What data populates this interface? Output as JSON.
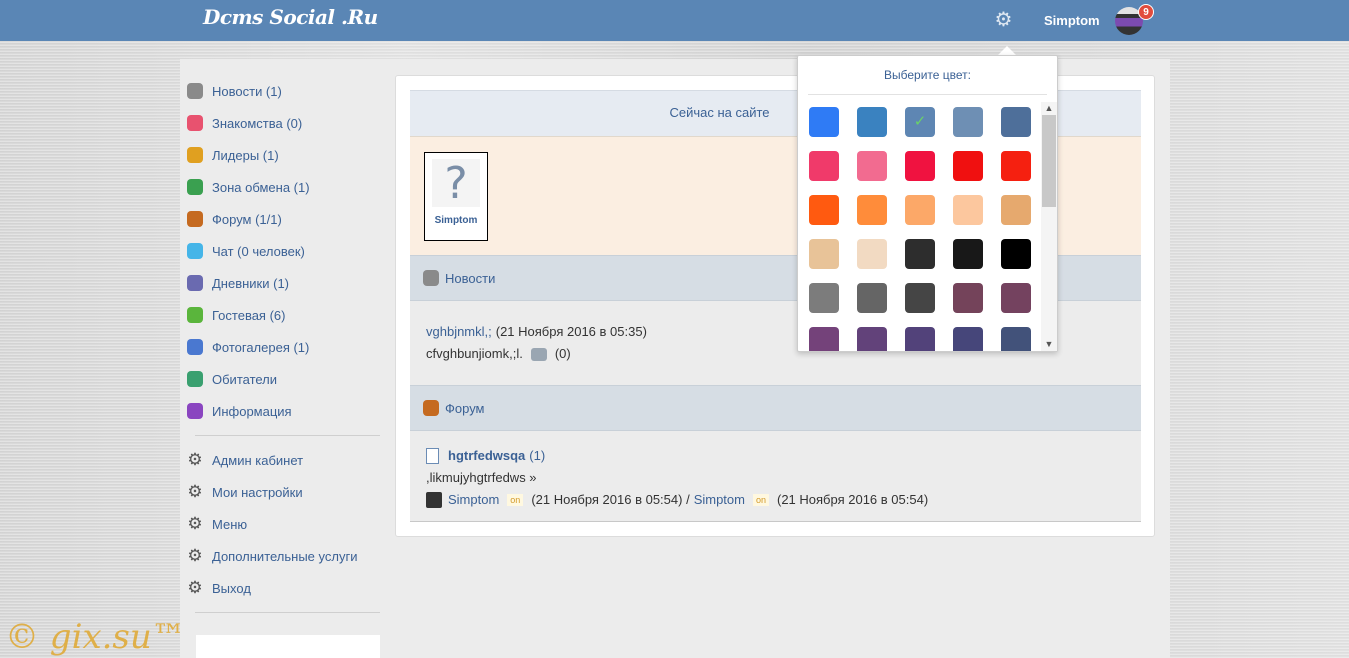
{
  "header": {
    "logo": "Dcms Social .Ru",
    "username": "Simptom",
    "notification_count": "9"
  },
  "sidebar": {
    "items": [
      {
        "label": "Новости (1)",
        "icon": "news-icon",
        "color": "#8a8a8a"
      },
      {
        "label": "Знакомства (0)",
        "icon": "heart-icon",
        "color": "#e8526f"
      },
      {
        "label": "Лидеры (1)",
        "icon": "trophy-icon",
        "color": "#e0a020"
      },
      {
        "label": "Зона обмена (1)",
        "icon": "exchange-icon",
        "color": "#3aa050"
      },
      {
        "label": "Форум (1/1)",
        "icon": "forum-icon",
        "color": "#c56a20"
      },
      {
        "label": "Чат (0 человек)",
        "icon": "chat-icon",
        "color": "#45b5e8"
      },
      {
        "label": "Дневники (1)",
        "icon": "diary-icon",
        "color": "#6a6ab0"
      },
      {
        "label": "Гостевая (6)",
        "icon": "guestbook-icon",
        "color": "#5ab53c"
      },
      {
        "label": "Фотогалерея (1)",
        "icon": "photo-icon",
        "color": "#4a78d0"
      },
      {
        "label": "Обитатели",
        "icon": "users-icon",
        "color": "#3aa070"
      },
      {
        "label": "Информация",
        "icon": "info-icon",
        "color": "#8a45c0"
      }
    ],
    "settings_items": [
      {
        "label": "Админ кабинет"
      },
      {
        "label": "Мои настройки"
      },
      {
        "label": "Меню"
      },
      {
        "label": "Дополнительные услуги"
      },
      {
        "label": "Выход"
      }
    ]
  },
  "main": {
    "online_title": "Сейчас на сайте",
    "online_user": "Simptom",
    "news_section": {
      "title": "Новости",
      "author": "vghbjnmkl,;",
      "date": "(21 Ноября 2016 в 05:35)",
      "text": "cfvghbunjiomk,;l.",
      "comments": "(0)"
    },
    "forum_section": {
      "title": "Форум",
      "topic": "hgtrfedwsqa",
      "topic_count": "(1)",
      "excerpt": ",likmujyhgtrfedws »",
      "author": "Simptom",
      "on_label": "on",
      "date1": "(21 Ноября 2016 в 05:54) /",
      "last_author": "Simptom",
      "date2": "(21 Ноября 2016 в 05:54)"
    }
  },
  "color_picker": {
    "title": "Выберите цвет:",
    "selected": "#5e86b3",
    "colors": [
      "#2f7bf5",
      "#3a82c0",
      "#5e86b3",
      "#6e8fb4",
      "#4e6f9a",
      "#f03a6a",
      "#f26b90",
      "#f01240",
      "#f01010",
      "#f52010",
      "#ff5a10",
      "#ff8c3a",
      "#fca868",
      "#fcc79e",
      "#e6a96e",
      "#e8c398",
      "#f2dac2",
      "#2d2d2d",
      "#181818",
      "#000000",
      "#7c7c7c",
      "#656565",
      "#454545",
      "#74435a",
      "#74425f",
      "#74427a",
      "#62427a",
      "#52427a",
      "#46467a",
      "#42527a"
    ]
  },
  "watermark": "© gix.su™"
}
